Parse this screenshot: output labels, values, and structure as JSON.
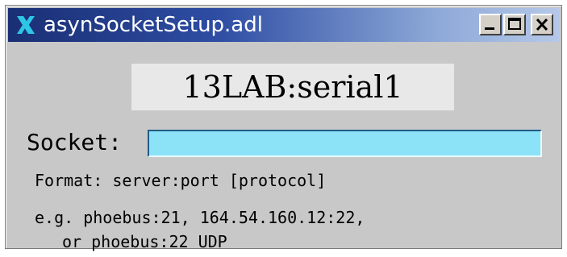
{
  "window": {
    "title": "asynSocketSetup.adl",
    "icon": "x-icon",
    "controls": {
      "minimize": "minimize-icon",
      "maximize": "maximize-icon",
      "close": "close-icon"
    }
  },
  "main": {
    "pv_name": "13LAB:serial1",
    "socket": {
      "label": "Socket:",
      "value": ""
    },
    "format_text": "Format: server:port [protocol]",
    "example_line1": "e.g. phoebus:21, 164.54.160.12:22,",
    "example_line2": "or phoebus:22 UDP"
  },
  "colors": {
    "background": "#c8c8c8",
    "title_bar_start": "#1a2f74",
    "title_bar_end": "#b5c8e8",
    "input_background": "#8ce3f7",
    "pv_panel": "#e8e8e8"
  }
}
